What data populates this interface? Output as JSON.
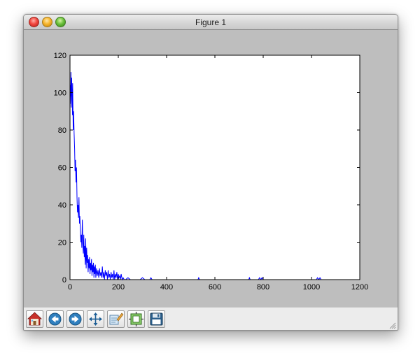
{
  "window": {
    "title": "Figure 1"
  },
  "toolbar": {
    "buttons": [
      {
        "name": "home-button",
        "icon": "home-icon"
      },
      {
        "name": "back-button",
        "icon": "back-arrow-icon"
      },
      {
        "name": "forward-button",
        "icon": "forward-arrow-icon"
      },
      {
        "name": "pan-button",
        "icon": "move-arrows-icon"
      },
      {
        "name": "zoom-button",
        "icon": "zoom-rect-icon"
      },
      {
        "name": "subplots-button",
        "icon": "subplots-icon"
      },
      {
        "name": "save-button",
        "icon": "floppy-disk-icon"
      }
    ]
  },
  "chart_data": {
    "type": "line",
    "title": "",
    "xlabel": "",
    "ylabel": "",
    "xlim": [
      0,
      1200
    ],
    "ylim": [
      0,
      120
    ],
    "xticks": [
      "0",
      "200",
      "400",
      "600",
      "800",
      "1000",
      "1200"
    ],
    "yticks": [
      "0",
      "20",
      "40",
      "60",
      "80",
      "100",
      "120"
    ],
    "grid": false,
    "series": [
      {
        "color": "#0000ff",
        "x": [
          1,
          2,
          3,
          4,
          5,
          6,
          7,
          8,
          9,
          10,
          11,
          12,
          13,
          14,
          15,
          17,
          19,
          21,
          23,
          25,
          27,
          29,
          31,
          33,
          35,
          37,
          39,
          41,
          43,
          45,
          47,
          49,
          51,
          53,
          55,
          57,
          59,
          61,
          63,
          65,
          67,
          69,
          71,
          73,
          75,
          77,
          79,
          81,
          83,
          85,
          87,
          89,
          91,
          93,
          95,
          97,
          99,
          101,
          103,
          105,
          107,
          110,
          113,
          116,
          119,
          122,
          125,
          128,
          131,
          134,
          137,
          140,
          143,
          146,
          149,
          152,
          155,
          158,
          161,
          164,
          167,
          170,
          173,
          176,
          179,
          182,
          185,
          188,
          191,
          194,
          197,
          200,
          203,
          206,
          209,
          212,
          216,
          220,
          225,
          230,
          240,
          250,
          270,
          290,
          300,
          310,
          330,
          335,
          340,
          360,
          380,
          400,
          450,
          500,
          530,
          533,
          536,
          560,
          600,
          650,
          700,
          740,
          743,
          746,
          780,
          785,
          790,
          795,
          800,
          850,
          900,
          950,
          1020,
          1025,
          1030,
          1035,
          1040,
          1100,
          1200
        ],
        "y": [
          94,
          104,
          98,
          111,
          92,
          96,
          108,
          100,
          102,
          88,
          105,
          95,
          82,
          80,
          90,
          78,
          70,
          58,
          64,
          52,
          60,
          44,
          36,
          40,
          33,
          44,
          30,
          34,
          26,
          20,
          24,
          17,
          32,
          20,
          14,
          24,
          12,
          18,
          8,
          22,
          6,
          17,
          9,
          13,
          4,
          11,
          6,
          12,
          3,
          9,
          5,
          11,
          2,
          8,
          4,
          9,
          1,
          7,
          3,
          8,
          1,
          6,
          2,
          5,
          1,
          6,
          2,
          4,
          1,
          7,
          1,
          4,
          0,
          5,
          2,
          4,
          0,
          5,
          1,
          3,
          0,
          4,
          1,
          3,
          0,
          5,
          0,
          3,
          1,
          4,
          0,
          3,
          1,
          2,
          0,
          3,
          0,
          1,
          0,
          0,
          1,
          0,
          0,
          0,
          1,
          0,
          0,
          1,
          0,
          0,
          0,
          0,
          0,
          0,
          0,
          1,
          0,
          0,
          0,
          0,
          0,
          0,
          1,
          0,
          0,
          1,
          0,
          1,
          0,
          0,
          0,
          0,
          0,
          1,
          0,
          1,
          0,
          0,
          0
        ]
      }
    ]
  }
}
